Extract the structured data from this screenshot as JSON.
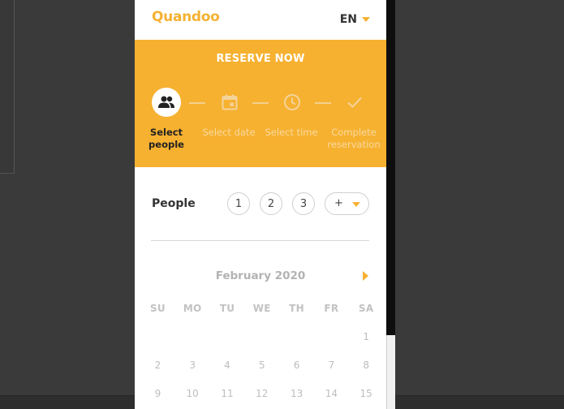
{
  "brand": {
    "logo_text": "Quandoo",
    "accent_color": "#f6b131"
  },
  "language": {
    "selected": "EN"
  },
  "banner": {
    "title": "RESERVE NOW"
  },
  "steps": [
    {
      "label": "Select people",
      "icon": "people-icon",
      "active": true
    },
    {
      "label": "Select date",
      "icon": "calendar-icon",
      "active": false
    },
    {
      "label": "Select time",
      "icon": "clock-icon",
      "active": false
    },
    {
      "label": "Complete reservation",
      "icon": "checkmark-icon",
      "active": false
    }
  ],
  "people": {
    "label": "People",
    "options": [
      "1",
      "2",
      "3"
    ],
    "more_label": "+"
  },
  "calendar": {
    "month": "February 2020",
    "weekdays": [
      "SU",
      "MO",
      "TU",
      "WE",
      "TH",
      "FR",
      "SA"
    ],
    "weeks": [
      [
        "",
        "",
        "",
        "",
        "",
        "",
        "1"
      ],
      [
        "2",
        "3",
        "4",
        "5",
        "6",
        "7",
        "8"
      ],
      [
        "9",
        "10",
        "11",
        "12",
        "13",
        "14",
        "15"
      ]
    ]
  }
}
